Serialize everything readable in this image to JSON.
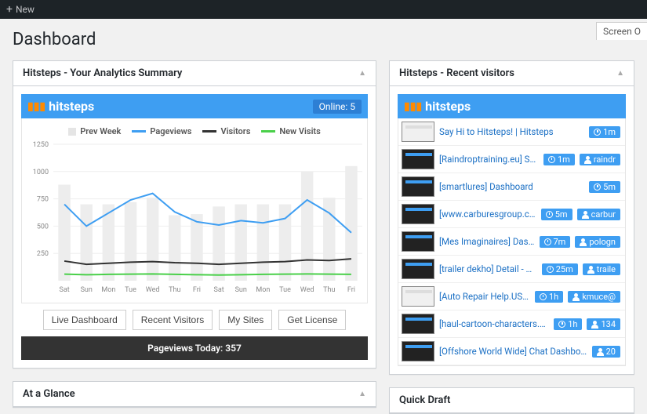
{
  "topbar": {
    "new_label": "New"
  },
  "screen_options": "Screen O",
  "page_title": "Dashboard",
  "summary_box": {
    "title": "Hitsteps - Your Analytics Summary",
    "brand": "hitsteps",
    "online_label": "Online: 5",
    "legend": {
      "prev": "Prev Week",
      "pv": "Pageviews",
      "vis": "Visitors",
      "new": "New Visits"
    },
    "buttons": {
      "live": "Live Dashboard",
      "recent": "Recent Visitors",
      "sites": "My Sites",
      "license": "Get License"
    },
    "footer": "Pageviews Today: 357"
  },
  "glance_box": {
    "title": "At a Glance"
  },
  "recent_box": {
    "title": "Hitsteps - Recent visitors",
    "brand": "hitsteps",
    "rows": [
      {
        "thumb": "light",
        "title": "Say Hi to Hitsteps! | Hitsteps",
        "time": "1m",
        "user": ""
      },
      {
        "thumb": "dark",
        "title": "[Raindroptraining.eu] Setting",
        "time": "1m",
        "user": "raindr"
      },
      {
        "thumb": "dark",
        "title": "[smartlures] Dashboard",
        "time": "5m",
        "user": ""
      },
      {
        "thumb": "dark",
        "title": "[www.carburesgroup.com] Dashboard",
        "time": "5m",
        "user": "carbur"
      },
      {
        "thumb": "dark",
        "title": "[Mes Imaginaires] Dashboard",
        "time": "7m",
        "user": "pologn"
      },
      {
        "thumb": "dark",
        "title": "[trailer dekho] Detail - Visitors",
        "time": "25m",
        "user": "traile"
      },
      {
        "thumb": "light",
        "title": "[Auto Repair Help.US] Dashboard",
        "time": "1h",
        "user": "kmuce@"
      },
      {
        "thumb": "dark",
        "title": "[haul-cartoon-characters.com] Detail - Visitors",
        "time": "1h",
        "user": "134"
      },
      {
        "thumb": "dark",
        "title": "[Offshore World Wide] Chat Dashboard - Messages",
        "time": "",
        "user": "20"
      }
    ]
  },
  "quick_draft": {
    "title": "Quick Draft"
  },
  "chart_data": {
    "type": "line",
    "categories": [
      "Sat",
      "Sun",
      "Mon",
      "Tue",
      "Wed",
      "Thu",
      "Fri",
      "Sat",
      "Sun",
      "Mon",
      "Tue",
      "Wed",
      "Thu",
      "Fri"
    ],
    "ylim": [
      0,
      1250
    ],
    "yticks": [
      250,
      500,
      750,
      1000,
      1250
    ],
    "series": [
      {
        "name": "Prev Week",
        "type": "bar",
        "values": [
          880,
          700,
          700,
          720,
          760,
          600,
          610,
          680,
          700,
          700,
          700,
          1000,
          760,
          1050
        ]
      },
      {
        "name": "Pageviews",
        "type": "line",
        "values": [
          700,
          500,
          620,
          740,
          800,
          630,
          540,
          510,
          550,
          530,
          570,
          740,
          620,
          440
        ]
      },
      {
        "name": "Visitors",
        "type": "line",
        "values": [
          180,
          150,
          160,
          170,
          175,
          165,
          160,
          150,
          160,
          170,
          175,
          190,
          185,
          200
        ]
      },
      {
        "name": "New Visits",
        "type": "line",
        "values": [
          60,
          55,
          58,
          60,
          62,
          58,
          55,
          52,
          55,
          58,
          60,
          62,
          60,
          58
        ]
      }
    ]
  }
}
